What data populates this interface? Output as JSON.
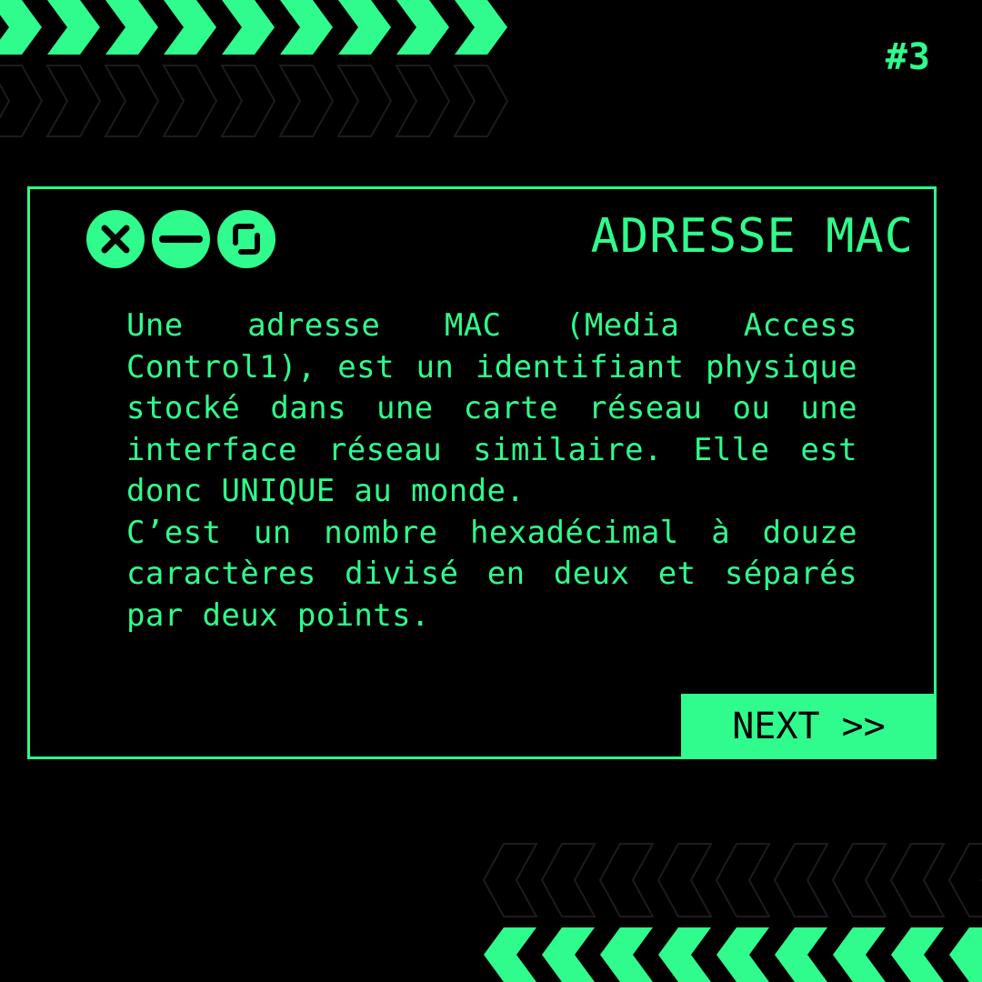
{
  "slide_number": "#3",
  "window": {
    "title": "ADRESSE MAC",
    "controls": [
      "close-icon",
      "minimize-icon",
      "restore-icon"
    ],
    "paragraphs": [
      "Une adresse MAC (Media Access Control1), est un identifiant physique stocké dans une carte réseau ou une interface réseau similaire. Elle est donc UNIQUE au monde.",
      "C’est un nombre hexadécimal à douze caractères divisé en deux et séparés par deux points."
    ],
    "next_label": "NEXT >>"
  },
  "colors": {
    "accent": "#2ffc8c",
    "background": "#000000",
    "decor_outline": "#1c1c1c"
  }
}
